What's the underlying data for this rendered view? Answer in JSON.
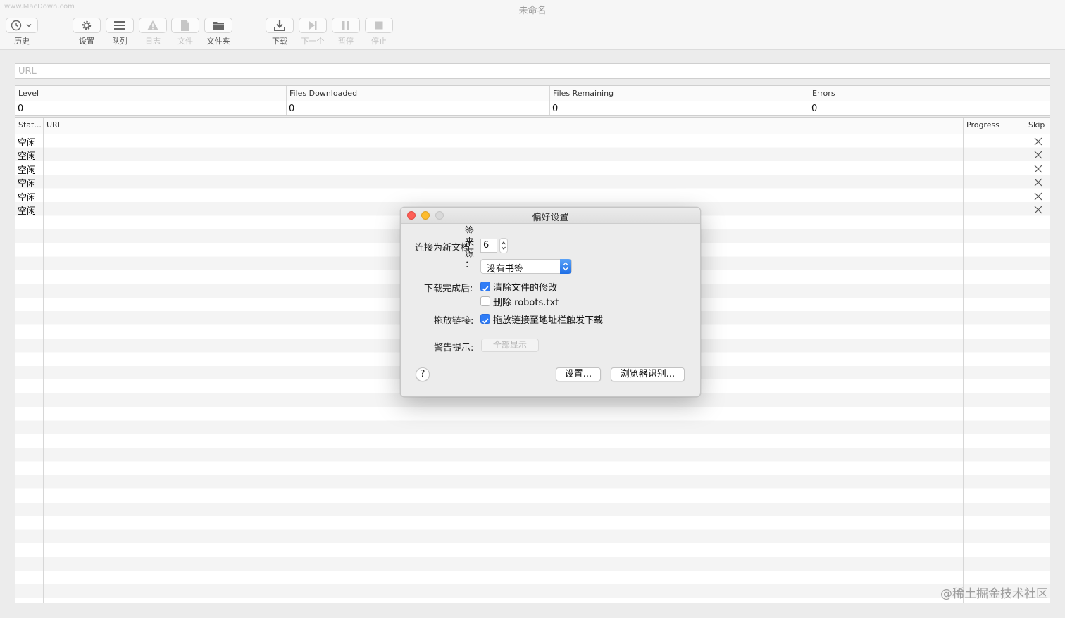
{
  "window": {
    "title": "未命名",
    "watermark_top": "www.MacDown.com"
  },
  "toolbar": {
    "history": "历史",
    "settings": "设置",
    "queue": "队列",
    "log": "日志",
    "file": "文件",
    "folder": "文件夹",
    "download": "下载",
    "next": "下一个",
    "pause": "暂停",
    "stop": "停止"
  },
  "url_field": {
    "placeholder": "URL",
    "value": ""
  },
  "stats": {
    "columns": [
      "Level",
      "Files Downloaded",
      "Files Remaining",
      "Errors"
    ],
    "values": [
      "0",
      "0",
      "0",
      "0"
    ]
  },
  "table": {
    "headers": {
      "status": "Stat...",
      "url": "URL",
      "progress": "Progress",
      "skip": "Skip"
    },
    "rows": [
      {
        "status": "空闲",
        "url": ""
      },
      {
        "status": "空闲",
        "url": ""
      },
      {
        "status": "空闲",
        "url": ""
      },
      {
        "status": "空闲",
        "url": ""
      },
      {
        "status": "空闲",
        "url": ""
      },
      {
        "status": "空闲",
        "url": ""
      }
    ]
  },
  "preferences": {
    "title": "偏好设置",
    "connections_label": "连接为新文档",
    "connections_value": "6",
    "bookmark_source_label_chars": [
      "签",
      "来",
      "源",
      "："
    ],
    "bookmark_source_value": "没有书签",
    "after_download_label": "下载完成后:",
    "option_clear_modifications": "清除文件的修改",
    "option_clear_modifications_checked": true,
    "option_delete_robots": "删除 robots.txt",
    "option_delete_robots_checked": false,
    "drag_links_label": "拖放链接:",
    "option_drag_links": "拖放链接至地址栏触发下载",
    "option_drag_links_checked": true,
    "alerts_label": "警告提示:",
    "show_all_button": "全部显示",
    "help_button": "?",
    "settings_button": "设置...",
    "browser_id_button": "浏览器识别..."
  },
  "watermark": "@稀土掘金技术社区",
  "colors": {
    "accent": "#2f7cf6",
    "close": "#fe5f57",
    "minimize": "#febc2e",
    "zoom_inactive": "#d9d9d9"
  }
}
